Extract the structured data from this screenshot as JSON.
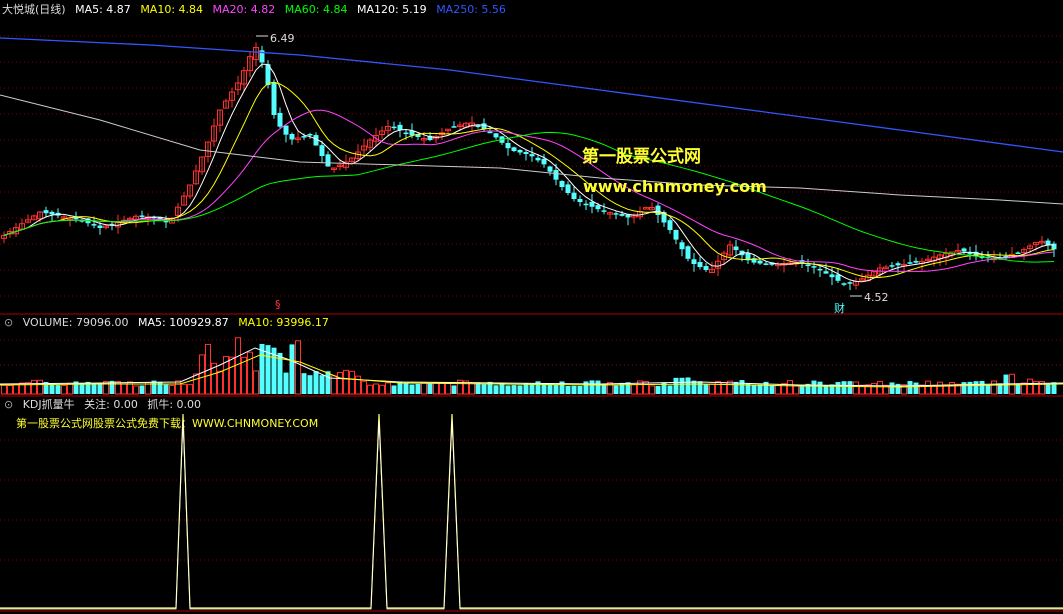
{
  "main_panel": {
    "title": "大悦城(日线)",
    "ma_labels": [
      {
        "text": "MA5: 4.87",
        "color": "#ffffff"
      },
      {
        "text": "MA10: 4.84",
        "color": "#ffff00"
      },
      {
        "text": "MA20: 4.82",
        "color": "#ff44ff"
      },
      {
        "text": "MA60: 4.84",
        "color": "#00ff00"
      },
      {
        "text": "MA120: 5.19",
        "color": "#ffffff"
      },
      {
        "text": "MA250: 5.56",
        "color": "#3355ff"
      }
    ],
    "high_label": "6.49",
    "low_label": "4.52",
    "marker_symbol": "§",
    "finance_marker": "财"
  },
  "volume_panel": {
    "title": "VOLUME: 79096.00",
    "ma5_label": "MA5: 100929.87",
    "ma10_label": "MA10: 93996.17"
  },
  "kdj_panel": {
    "title": "KDJ抓量牛",
    "focus_label": "关注: 0.00",
    "grab_label": "抓牛: 0.00",
    "download_text": "第一股票公式网股票公式免费下载：WWW.CHNMONEY.COM"
  },
  "watermark": {
    "line1": "第一股票公式网",
    "line2": "www.chnmoney.com"
  },
  "colors": {
    "up": "#ff3030",
    "down": "#54ffff",
    "grid": "#8b0000",
    "panel_border": "#b00000",
    "ma5": "#ffffff",
    "ma10": "#ffff00",
    "ma20": "#ff44ff",
    "ma60": "#00ff00",
    "ma120": "#cccccc",
    "ma250": "#3355ff",
    "kdj_line": "#ffff66"
  },
  "chart_data": [
    {
      "type": "candlestick",
      "high": 6.49,
      "low": 4.52,
      "ma_values": {
        "MA5": 4.87,
        "MA10": 4.84,
        "MA20": 4.82,
        "MA60": 4.84,
        "MA120": 5.19,
        "MA250": 5.56
      }
    },
    {
      "type": "bar",
      "series": [
        {
          "name": "VOLUME",
          "last": 79096.0
        },
        {
          "name": "MA5",
          "last": 100929.87
        },
        {
          "name": "MA10",
          "last": 93996.17
        }
      ]
    },
    {
      "type": "line",
      "series": [
        {
          "name": "关注",
          "last": 0.0
        },
        {
          "name": "抓牛",
          "last": 0.0
        }
      ],
      "spikes": 3
    }
  ]
}
